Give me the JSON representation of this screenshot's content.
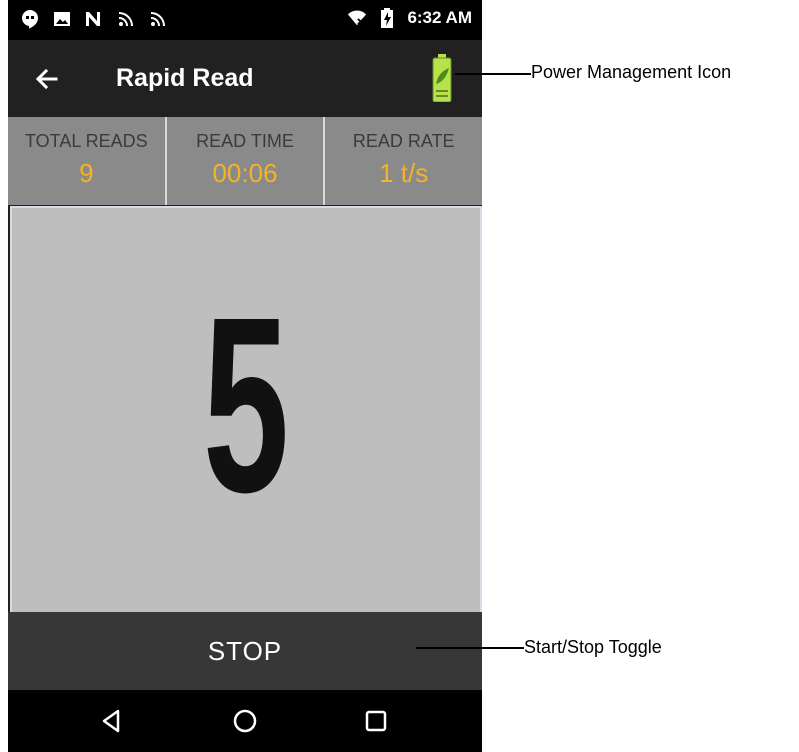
{
  "status_bar": {
    "time": "6:32 AM",
    "icons_left": [
      "hangouts-icon",
      "image-icon",
      "nfc-icon",
      "rfid-icon",
      "rfid-icon"
    ],
    "icons_right": [
      "wifi-off-icon",
      "battery-charging-icon"
    ]
  },
  "app_bar": {
    "title": "Rapid Read",
    "back_icon": "arrow-back-icon",
    "power_icon": "battery-leaf-icon"
  },
  "stats": [
    {
      "label": "TOTAL READS",
      "value": "9"
    },
    {
      "label": "READ TIME",
      "value": "00:06"
    },
    {
      "label": "READ RATE",
      "value": "1 t/s"
    }
  ],
  "count": "5",
  "stop_button": {
    "label": "STOP"
  },
  "nav": [
    "back-triangle-icon",
    "home-circle-icon",
    "recents-square-icon"
  ],
  "callouts": {
    "power": "Power Management Icon",
    "toggle": "Start/Stop Toggle"
  },
  "colors": {
    "accent_value": "#f4b224",
    "stats_bg": "#8a8a8a",
    "count_bg": "#bebebe",
    "appbar_bg": "#212121",
    "stop_bg": "#373737",
    "battery_green": "#b6e24a"
  }
}
